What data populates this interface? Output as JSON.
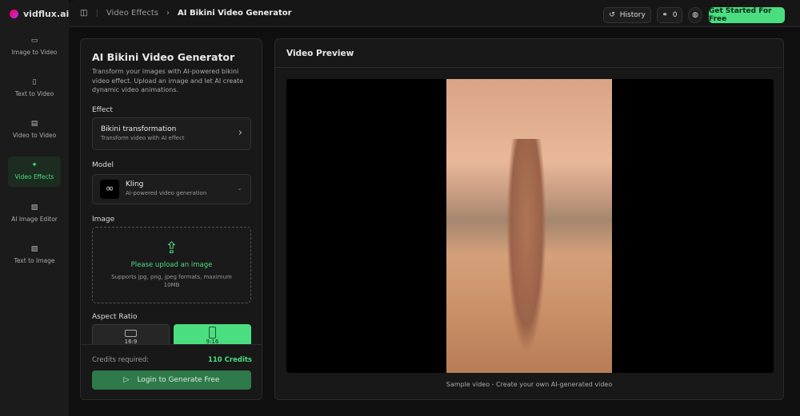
{
  "brand": "vidflux.ai",
  "sidebar": {
    "items": [
      {
        "label": "Image to Video",
        "icon": "video-camera-icon"
      },
      {
        "label": "Text to Video",
        "icon": "document-icon"
      },
      {
        "label": "Video to Video",
        "icon": "clapper-icon"
      },
      {
        "label": "Video Effects",
        "icon": "sparkle-icon",
        "active": true
      },
      {
        "label": "AI Image Editor",
        "icon": "image-icon"
      },
      {
        "label": "Text to Image",
        "icon": "image-icon"
      }
    ]
  },
  "header": {
    "breadcrumb": [
      "Video Effects",
      "AI Bikini Video Generator"
    ],
    "history": "History",
    "credits": "0",
    "cta": "Get Started For Free"
  },
  "form": {
    "title": "AI Bikini Video Generator",
    "description": "Transform your images with AI-powered bikini video effect. Upload an image and let AI create dynamic video animations.",
    "effect_label": "Effect",
    "effect_name": "Bikini transformation",
    "effect_desc": "Transform video with AI effect",
    "model_label": "Model",
    "model_name": "Kling",
    "model_desc": "AI-powered video generation",
    "image_label": "Image",
    "upload_title": "Please upload an image",
    "upload_hint": "Supports jpg, png, jpeg formats, maximum 10MB",
    "aspect_label": "Aspect Ratio",
    "aspect_options": [
      "16:9",
      "9:16"
    ],
    "credits_label": "Credits required:",
    "credits_value": "110 Credits",
    "generate": "Login to Generate Free"
  },
  "preview": {
    "title": "Video Preview",
    "caption": "Sample video - Create your own AI-generated video"
  },
  "colors": {
    "accent": "#4ade80"
  }
}
